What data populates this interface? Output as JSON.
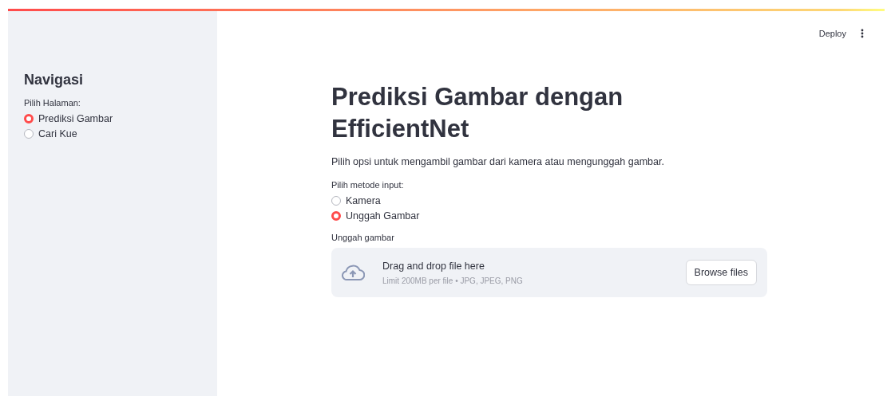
{
  "sidebar": {
    "heading": "Navigasi",
    "radio": {
      "label": "Pilih Halaman:",
      "options": [
        {
          "label": "Prediksi Gambar",
          "selected": true
        },
        {
          "label": "Cari Kue",
          "selected": false
        }
      ]
    }
  },
  "header": {
    "deploy_button": "Deploy"
  },
  "main": {
    "title": "Prediksi Gambar dengan EfficientNet",
    "description": "Pilih opsi untuk mengambil gambar dari kamera atau mengunggah gambar.",
    "radio": {
      "label": "Pilih metode input:",
      "options": [
        {
          "label": "Kamera",
          "selected": false
        },
        {
          "label": "Unggah Gambar",
          "selected": true
        }
      ]
    },
    "uploader": {
      "label": "Unggah gambar",
      "instruction": "Drag and drop file here",
      "limit": "Limit 200MB per file • JPG, JPEG, PNG",
      "button": "Browse files"
    }
  }
}
